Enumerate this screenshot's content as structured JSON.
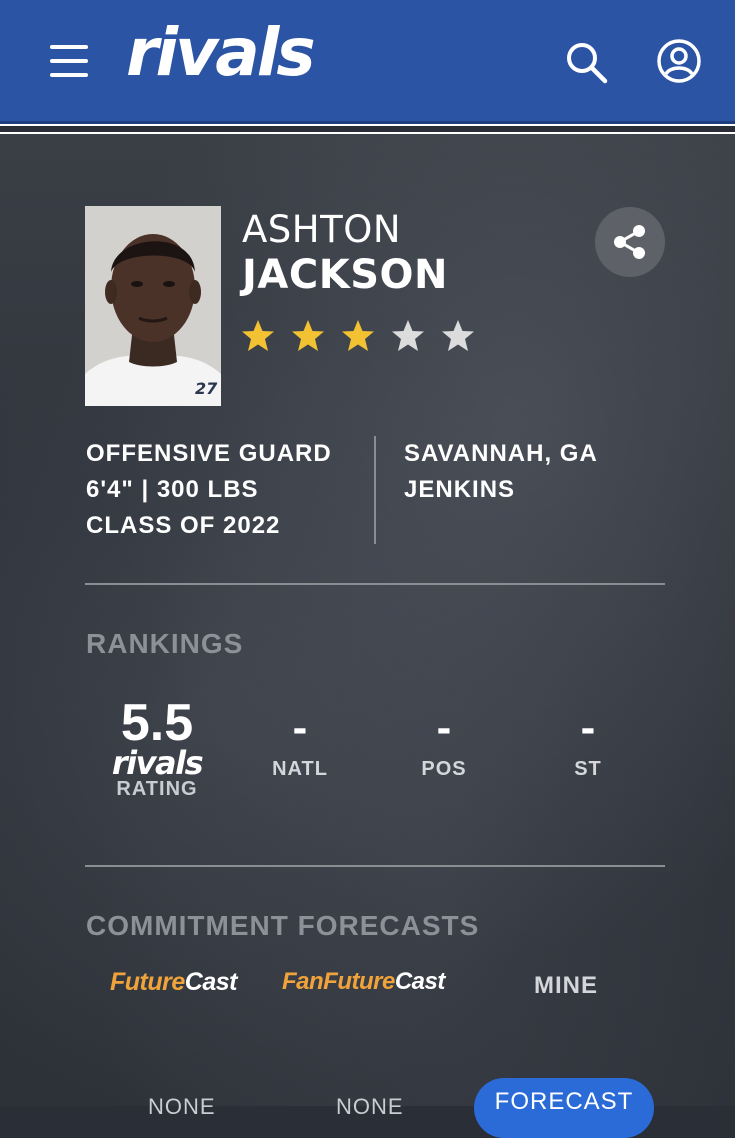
{
  "header": {
    "logo_text": "rivals",
    "icons": {
      "menu": "menu-icon",
      "search": "search-icon",
      "account": "account-icon"
    }
  },
  "player": {
    "first_name": "ASHTON",
    "last_name": "JACKSON",
    "stars_filled": 3,
    "stars_total": 5,
    "position": "OFFENSIVE GUARD",
    "measurables": "6'4\" | 300 LBS",
    "class": "CLASS OF 2022",
    "hometown": "SAVANNAH, GA",
    "school": "JENKINS",
    "jersey_number": "27"
  },
  "rankings": {
    "title": "RANKINGS",
    "rating_value": "5.5",
    "rating_logo": "rivals",
    "rating_label": "RATING",
    "columns": [
      {
        "value": "-",
        "label": "NATL"
      },
      {
        "value": "-",
        "label": "POS"
      },
      {
        "value": "-",
        "label": "ST"
      }
    ]
  },
  "forecasts": {
    "title": "COMMITMENT FORECASTS",
    "tab_futurecast_future": "Future",
    "tab_futurecast_cast": "Cast",
    "tab_fanfuturecast_future": "FanFuture",
    "tab_fanfuturecast_cast": "Cast",
    "tab_mine": "MINE",
    "none_1": "NONE",
    "none_2": "NONE",
    "forecast_button": "FORECAST"
  },
  "colors": {
    "header_bg": "#2b54a4",
    "star_filled": "#f2c232",
    "star_empty": "#dcdcdc",
    "futurecast_orange": "#f0a33a",
    "forecast_button": "#2b6bd8"
  }
}
